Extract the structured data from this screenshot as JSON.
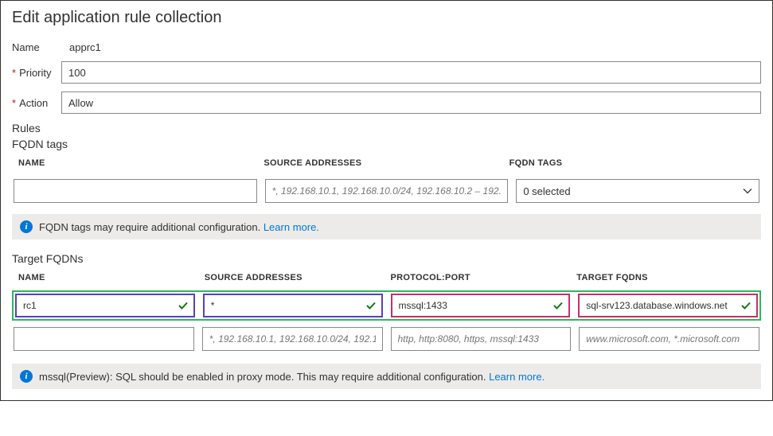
{
  "title": "Edit application rule collection",
  "form": {
    "name_label": "Name",
    "name_value": "apprc1",
    "priority_label": "Priority",
    "priority_value": "100",
    "action_label": "Action",
    "action_value": "Allow"
  },
  "rules_label": "Rules",
  "fqdn_tags": {
    "label": "FQDN tags",
    "headers": {
      "name": "NAME",
      "source": "SOURCE ADDRESSES",
      "tags": "FQDN TAGS"
    },
    "row": {
      "name": "",
      "source_placeholder": "*, 192.168.10.1, 192.168.10.0/24, 192.168.10.2 – 192.168…",
      "tags_selected": "0 selected"
    },
    "info": "FQDN tags may require additional configuration.",
    "learn_more": "Learn more."
  },
  "target_fqdns": {
    "label": "Target FQDNs",
    "headers": {
      "name": "NAME",
      "source": "SOURCE ADDRESSES",
      "protocol": "PROTOCOL:PORT",
      "target": "TARGET FQDNS"
    },
    "row1": {
      "name": "rc1",
      "source": "*",
      "protocol": "mssql:1433",
      "target": "sql-srv123.database.windows.net"
    },
    "row2": {
      "name": "",
      "source_placeholder": "*, 192.168.10.1, 192.168.10.0/24, 192.16…",
      "protocol_placeholder": "http, http:8080, https, mssql:1433",
      "target_placeholder": "www.microsoft.com, *.microsoft.com"
    },
    "info": "mssql(Preview): SQL should be enabled in proxy mode. This may require additional configuration.",
    "learn_more": "Learn more."
  }
}
